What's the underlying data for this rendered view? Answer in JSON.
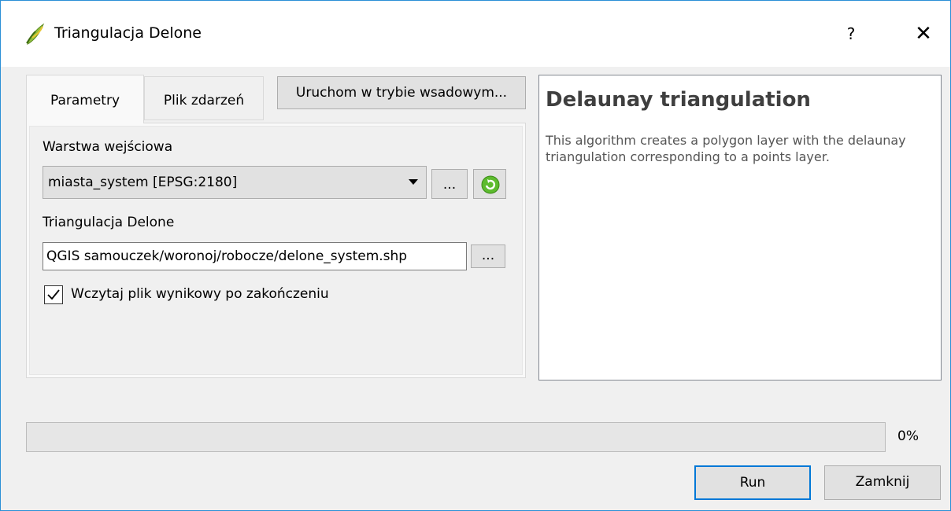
{
  "window": {
    "title": "Triangulacja Delone",
    "help_glyph": "?",
    "close_glyph": "✕",
    "icon": "qgis-icon"
  },
  "tabs": [
    {
      "label": "Parametry",
      "active": true
    },
    {
      "label": "Plik zdarzeń",
      "active": false
    }
  ],
  "batch_button_label": "Uruchom w trybie wsadowym...",
  "params": {
    "input_layer_label": "Warstwa wejściowa",
    "input_layer_value": "miasta_system [EPSG:2180]",
    "browse_label": "...",
    "refresh_icon": "refresh-icon",
    "output_label": "Triangulacja Delone",
    "output_value": "QGIS samouczek/woronoj/robocze/delone_system.shp",
    "output_browse_label": "...",
    "load_checkbox_label": "Wczytaj plik wynikowy po zakończeniu",
    "load_checked": true
  },
  "help": {
    "title": "Delaunay triangulation",
    "body": "This algorithm creates a polygon layer with the delaunay triangulation corresponding to a points layer."
  },
  "progress": {
    "value": 0,
    "text": "0%"
  },
  "buttons": {
    "run": "Run",
    "close": "Zamknij"
  },
  "colors": {
    "accent": "#0078d7",
    "window_border": "#2b8fd6",
    "progress_fill": "#06b025"
  }
}
